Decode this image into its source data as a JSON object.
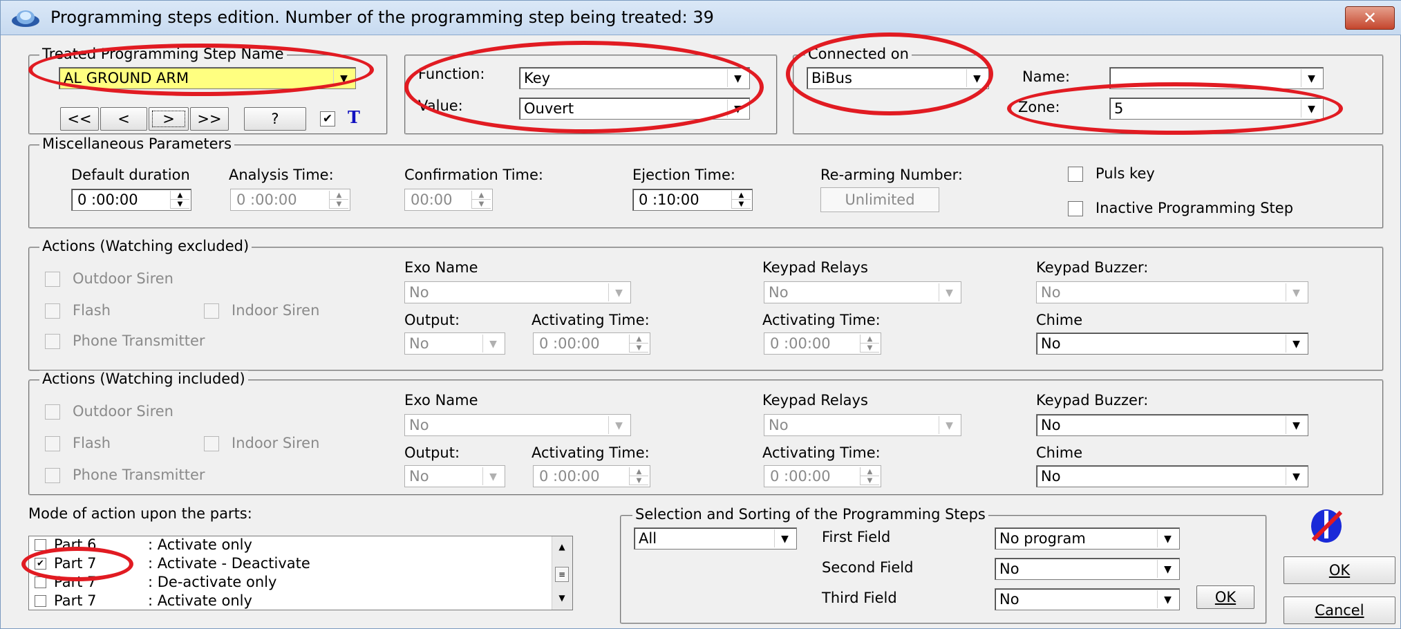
{
  "window": {
    "title": "Programming steps edition.  Number of the programming step being treated: 39",
    "close_label": "✕"
  },
  "treated": {
    "group_title": "Treated Programming Step Name",
    "name_value": "AL GROUND ARM",
    "nav_first": "<<",
    "nav_prev": "<",
    "nav_next": ">",
    "nav_last": ">>",
    "help": "?",
    "checkbox_mark": "✔",
    "t_label": "T"
  },
  "function_group": {
    "function_label": "Function:",
    "function_value": "Key",
    "value_label": "Value:",
    "value_value": "Ouvert"
  },
  "connected": {
    "group_title": "Connected on",
    "bus_value": "BiBus",
    "name_label": "Name:",
    "name_value": "",
    "zone_label": "Zone:",
    "zone_value": "5"
  },
  "misc": {
    "group_title": "Miscellaneous Parameters",
    "default_duration_label": "Default duration",
    "default_duration_value": "0 :00:00",
    "analysis_time_label": "Analysis Time:",
    "analysis_time_value": "0 :00:00",
    "confirmation_time_label": "Confirmation Time:",
    "confirmation_time_value": "00:00",
    "ejection_time_label": "Ejection Time:",
    "ejection_time_value": "0 :10:00",
    "rearming_label": "Re-arming Number:",
    "rearming_value": "Unlimited",
    "puls_key_label": "Puls key",
    "inactive_label": "Inactive Programming Step"
  },
  "actions_excluded": {
    "group_title": "Actions (Watching excluded)",
    "outdoor_siren": "Outdoor Siren",
    "flash": "Flash",
    "indoor_siren": "Indoor Siren",
    "phone_transmitter": "Phone Transmitter",
    "exo_name_label": "Exo Name",
    "exo_name_value": "No",
    "output_label": "Output:",
    "output_value": "No",
    "activating_time_label": "Activating Time:",
    "activating_time_value": "0 :00:00",
    "keypad_relays_label": "Keypad Relays",
    "keypad_relays_value": "No",
    "keypad_activating_label": "Activating Time:",
    "keypad_activating_value": "0 :00:00",
    "keypad_buzzer_label": "Keypad Buzzer:",
    "keypad_buzzer_value": "No",
    "chime_label": "Chime",
    "chime_value": "No"
  },
  "actions_included": {
    "group_title": "Actions (Watching included)",
    "outdoor_siren": "Outdoor Siren",
    "flash": "Flash",
    "indoor_siren": "Indoor Siren",
    "phone_transmitter": "Phone Transmitter",
    "exo_name_label": "Exo Name",
    "exo_name_value": "No",
    "output_label": "Output:",
    "output_value": "No",
    "activating_time_label": "Activating Time:",
    "activating_time_value": "0 :00:00",
    "keypad_relays_label": "Keypad Relays",
    "keypad_relays_value": "No",
    "keypad_activating_label": "Activating Time:",
    "keypad_activating_value": "0 :00:00",
    "keypad_buzzer_label": "Keypad Buzzer:",
    "keypad_buzzer_value": "No",
    "chime_label": "Chime",
    "chime_value": "No"
  },
  "parts": {
    "label": "Mode of action upon the parts:",
    "rows": [
      {
        "name": "Part 6",
        "mode": ": Activate only",
        "checked": ""
      },
      {
        "name": "Part 7",
        "mode": ": Activate - Deactivate",
        "checked": "✔"
      },
      {
        "name": "Part 7",
        "mode": ": De-activate only",
        "checked": ""
      },
      {
        "name": "Part 7",
        "mode": ": Activate only",
        "checked": ""
      }
    ]
  },
  "selection": {
    "group_title": "Selection and Sorting of the Programming Steps",
    "filter_value": "All",
    "first_field_label": "First Field",
    "first_field_value": "No program",
    "second_field_label": "Second Field",
    "second_field_value": "No",
    "third_field_label": "Third Field",
    "third_field_value": "No",
    "ok_label": "OK"
  },
  "buttons": {
    "ok": "OK",
    "cancel": "Cancel"
  },
  "colors": {
    "highlight_ellipse": "#e11b22",
    "name_field_bg": "#ffff80",
    "t_label": "#1010c0"
  }
}
